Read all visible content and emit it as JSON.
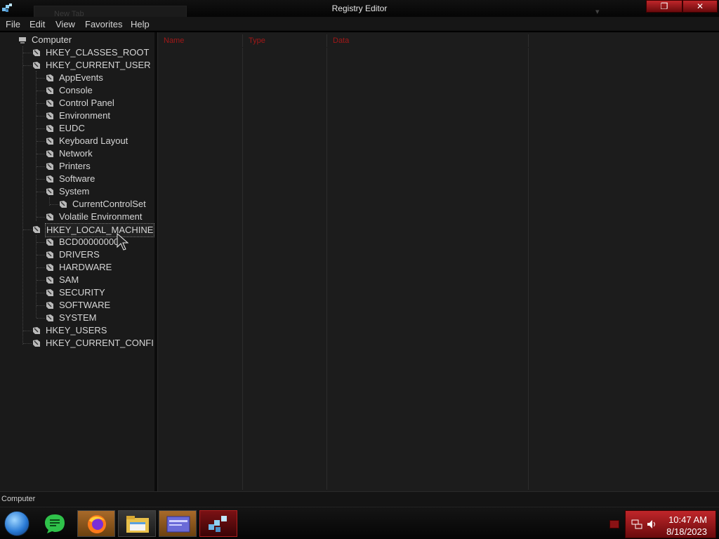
{
  "window": {
    "title": "Registry Editor",
    "background_tab": "New Tab"
  },
  "menu": [
    "File",
    "Edit",
    "View",
    "Favorites",
    "Help"
  ],
  "tree": {
    "root": "Computer",
    "nodes": [
      {
        "label": "HKEY_CLASSES_ROOT",
        "level": 1
      },
      {
        "label": "HKEY_CURRENT_USER",
        "level": 1
      },
      {
        "label": "AppEvents",
        "level": 2
      },
      {
        "label": "Console",
        "level": 2
      },
      {
        "label": "Control Panel",
        "level": 2
      },
      {
        "label": "Environment",
        "level": 2
      },
      {
        "label": "EUDC",
        "level": 2
      },
      {
        "label": "Keyboard Layout",
        "level": 2
      },
      {
        "label": "Network",
        "level": 2
      },
      {
        "label": "Printers",
        "level": 2
      },
      {
        "label": "Software",
        "level": 2
      },
      {
        "label": "System",
        "level": 2
      },
      {
        "label": "CurrentControlSet",
        "level": 3
      },
      {
        "label": "Volatile Environment",
        "level": 2
      },
      {
        "label": "HKEY_LOCAL_MACHINE",
        "level": 1,
        "selected": true
      },
      {
        "label": "BCD00000000",
        "level": 2
      },
      {
        "label": "DRIVERS",
        "level": 2
      },
      {
        "label": "HARDWARE",
        "level": 2
      },
      {
        "label": "SAM",
        "level": 2
      },
      {
        "label": "SECURITY",
        "level": 2
      },
      {
        "label": "SOFTWARE",
        "level": 2
      },
      {
        "label": "SYSTEM",
        "level": 2
      },
      {
        "label": "HKEY_USERS",
        "level": 1
      },
      {
        "label": "HKEY_CURRENT_CONFI",
        "level": 1
      }
    ]
  },
  "list": {
    "columns": [
      "Name",
      "Type",
      "Data"
    ]
  },
  "status": {
    "path": "Computer"
  },
  "taskbar": {
    "apps": [
      "start-orb",
      "notes",
      "firefox",
      "file-explorer",
      "control-panel",
      "registry-editor"
    ]
  },
  "tray": {
    "time": "10:47 AM",
    "date": "8/18/2023"
  },
  "colors": {
    "accent": "#c0262a",
    "header_text": "#a01818",
    "pane_bg": "#1a1a1a"
  }
}
